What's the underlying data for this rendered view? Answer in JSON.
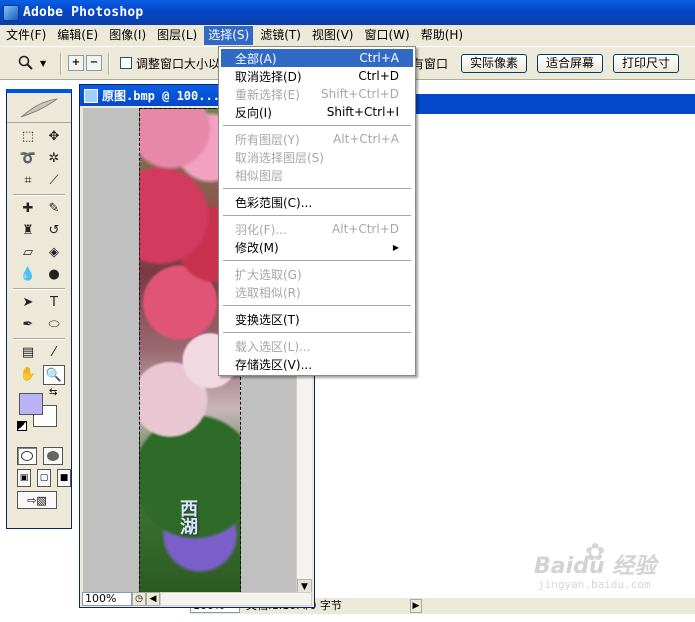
{
  "window": {
    "title": "Adobe Photoshop"
  },
  "menubar": {
    "items": [
      {
        "label": "文件(F)"
      },
      {
        "label": "编辑(E)"
      },
      {
        "label": "图像(I)"
      },
      {
        "label": "图层(L)"
      },
      {
        "label": "选择(S)"
      },
      {
        "label": "滤镜(T)"
      },
      {
        "label": "视图(V)"
      },
      {
        "label": "窗口(W)"
      },
      {
        "label": "帮助(H)"
      }
    ]
  },
  "options_bar": {
    "resize_windows_label": "调整窗口大小以",
    "all_windows_label": "有窗口",
    "actual_pixels": "实际像素",
    "fit_screen": "适合屏幕",
    "print_size": "打印尺寸"
  },
  "select_menu": {
    "items": [
      {
        "label": "全部(A)",
        "shortcut": "Ctrl+A",
        "state": "highlight"
      },
      {
        "label": "取消选择(D)",
        "shortcut": "Ctrl+D",
        "state": "enabled"
      },
      {
        "label": "重新选择(E)",
        "shortcut": "Shift+Ctrl+D",
        "state": "disabled"
      },
      {
        "label": "反向(I)",
        "shortcut": "Shift+Ctrl+I",
        "state": "enabled"
      },
      {
        "separator": true
      },
      {
        "label": "所有图层(Y)",
        "shortcut": "Alt+Ctrl+A",
        "state": "disabled"
      },
      {
        "label": "取消选择图层(S)",
        "shortcut": "",
        "state": "disabled"
      },
      {
        "label": "相似图层",
        "shortcut": "",
        "state": "disabled"
      },
      {
        "separator": true
      },
      {
        "label": "色彩范围(C)...",
        "shortcut": "",
        "state": "enabled"
      },
      {
        "separator": true
      },
      {
        "label": "羽化(F)...",
        "shortcut": "Alt+Ctrl+D",
        "state": "disabled"
      },
      {
        "label": "修改(M)",
        "shortcut": "",
        "state": "enabled",
        "submenu": true
      },
      {
        "separator": true
      },
      {
        "label": "扩大选取(G)",
        "shortcut": "",
        "state": "disabled"
      },
      {
        "label": "选取相似(R)",
        "shortcut": "",
        "state": "disabled"
      },
      {
        "separator": true
      },
      {
        "label": "变换选区(T)",
        "shortcut": "",
        "state": "enabled"
      },
      {
        "separator": true
      },
      {
        "label": "载入选区(L)...",
        "shortcut": "",
        "state": "disabled"
      },
      {
        "label": "存储选区(V)...",
        "shortcut": "",
        "state": "enabled"
      }
    ]
  },
  "document": {
    "title": "原图.bmp @ 100...",
    "zoom": "100%",
    "image_text": "西湖"
  },
  "back_document": {
    "zoom": "100%",
    "doc_size": "文档:1.10M/0 字节"
  },
  "colors": {
    "foreground": "#b9b3f5",
    "background": "#ffffff",
    "menu_highlight": "#316ac5",
    "titlebar": "#0348c8"
  },
  "watermark": {
    "brand": "Baidu 经验",
    "url": "jingyan.baidu.com"
  }
}
